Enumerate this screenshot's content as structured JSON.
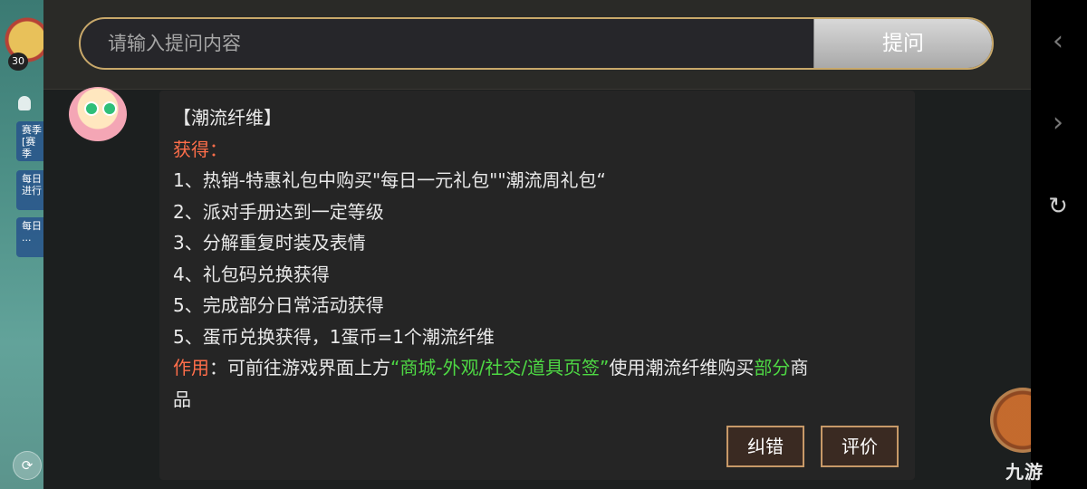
{
  "game_strip": {
    "level": "30",
    "tags": [
      {
        "line1": "赛季",
        "line2": "[赛季"
      },
      {
        "line1": "每日",
        "line2": "进行"
      },
      {
        "line1": "每日",
        "line2": "..."
      }
    ]
  },
  "search": {
    "placeholder": "请输入提问内容",
    "ask_label": "提问"
  },
  "answer": {
    "title": "【潮流纤维】",
    "obtain_label": "获得：",
    "items": [
      "1、热销-特惠礼包中购买\"每日一元礼包\"\"潮流周礼包“",
      "2、派对手册达到一定等级",
      "3、分解重复时装及表情",
      "4、礼包码兑换获得",
      "5、完成部分日常活动获得",
      "5、蛋币兑换获得，1蛋币=1个潮流纤维"
    ],
    "usage_label": "作用",
    "usage_pre": "：可前往游戏界面上方",
    "usage_highlight": "“商城-外观/社交/道具页签”",
    "usage_mid": "使用潮流纤维购买",
    "usage_partial": "部分",
    "usage_post": "商",
    "usage_line2": "品"
  },
  "buttons": {
    "correct_label": "纠错",
    "rate_label": "评价"
  },
  "watermark": "九游",
  "colors": {
    "accent_border": "#c8a86a",
    "label_red": "#ff6e4a",
    "highlight_green": "#4ed844"
  }
}
